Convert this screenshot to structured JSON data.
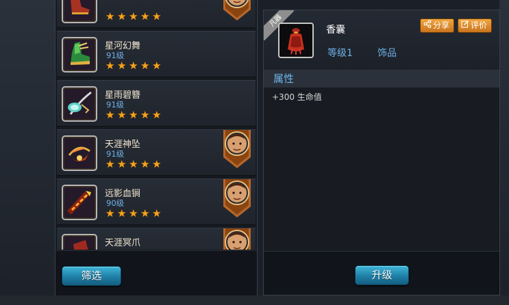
{
  "items": [
    {
      "name": "",
      "level": "",
      "stars": 5,
      "hero": true,
      "art": "shoe-red"
    },
    {
      "name": "星河幻舞",
      "level": "91级",
      "stars": 5,
      "hero": false,
      "art": "shoe-green"
    },
    {
      "name": "星雨碧簪",
      "level": "91级",
      "stars": 5,
      "hero": false,
      "art": "hairpin"
    },
    {
      "name": "天涯神坠",
      "level": "91级",
      "stars": 5,
      "hero": true,
      "art": "pendant"
    },
    {
      "name": "远影血锏",
      "level": "90级",
      "stars": 5,
      "hero": true,
      "art": "mace"
    },
    {
      "name": "天涯冥爪",
      "level": "",
      "stars": 0,
      "hero": true,
      "art": "claw"
    }
  ],
  "filter_label": "筛选",
  "detail": {
    "quality_tag": "凡器",
    "name": "香囊",
    "grade": "等级1",
    "type": "饰品",
    "share_label": "分享",
    "rate_label": "评价",
    "attr_title": "属性",
    "attr_line": "+300 生命值",
    "upgrade_label": "升级"
  },
  "colors": {
    "star": "#f6a21c",
    "level_text": "#6fb0e6",
    "button_blue": "#1f7fa6",
    "button_orange": "#e08a2a"
  }
}
